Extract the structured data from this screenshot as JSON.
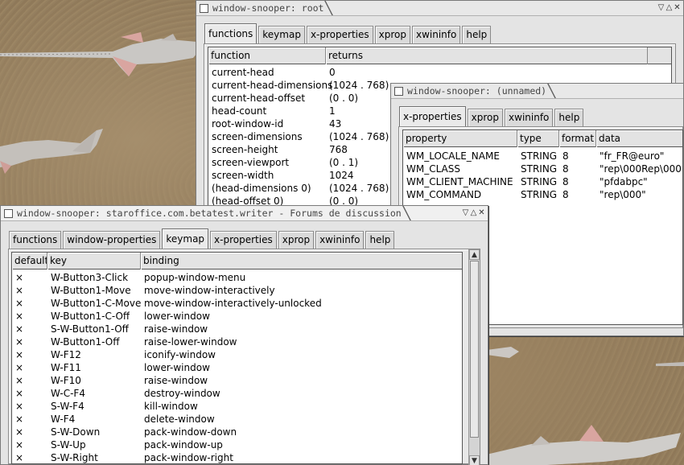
{
  "root_window": {
    "title": "window-snooper: root",
    "tabs": [
      "functions",
      "keymap",
      "x-properties",
      "xprop",
      "xwininfo",
      "help"
    ],
    "selected_tab": 0,
    "columns": [
      "function",
      "returns"
    ],
    "rows": [
      [
        "current-head",
        "0"
      ],
      [
        "current-head-dimensions",
        "(1024 . 768)"
      ],
      [
        "current-head-offset",
        "(0 . 0)"
      ],
      [
        "head-count",
        "1"
      ],
      [
        "root-window-id",
        "43"
      ],
      [
        "screen-dimensions",
        "(1024 . 768)"
      ],
      [
        "screen-height",
        "768"
      ],
      [
        "screen-viewport",
        "(0 . 1)"
      ],
      [
        "screen-width",
        "1024"
      ],
      [
        "(head-dimensions 0)",
        "(1024 . 768)"
      ],
      [
        "(head-offset 0)",
        "(0 . 0)"
      ]
    ]
  },
  "unnamed_window": {
    "title": "window-snooper: (unnamed)",
    "tabs": [
      "x-properties",
      "xprop",
      "xwininfo",
      "help"
    ],
    "selected_tab": 0,
    "columns": [
      "property",
      "type",
      "format",
      "data"
    ],
    "rows": [
      [
        "WM_LOCALE_NAME",
        "STRING",
        "8",
        "\"fr_FR@euro\""
      ],
      [
        "WM_CLASS",
        "STRING",
        "8",
        "\"rep\\000Rep\\000\""
      ],
      [
        "WM_CLIENT_MACHINE",
        "STRING",
        "8",
        "\"pfdabpc\""
      ],
      [
        "WM_COMMAND",
        "STRING",
        "8",
        "\"rep\\000\""
      ]
    ]
  },
  "writer_window": {
    "title": "window-snooper: staroffice.com.betatest.writer - Forums de discussion",
    "tabs": [
      "functions",
      "window-properties",
      "keymap",
      "x-properties",
      "xprop",
      "xwininfo",
      "help"
    ],
    "selected_tab": 2,
    "columns": [
      "default",
      "key",
      "binding"
    ],
    "rows": [
      [
        "×",
        "W-Button3-Click",
        "popup-window-menu"
      ],
      [
        "×",
        "W-Button1-Move",
        "move-window-interactively"
      ],
      [
        "×",
        "W-Button1-C-Move",
        "move-window-interactively-unlocked"
      ],
      [
        "×",
        "W-Button1-C-Off",
        "lower-window"
      ],
      [
        "×",
        "S-W-Button1-Off",
        "raise-window"
      ],
      [
        "×",
        "W-Button1-Off",
        "raise-lower-window"
      ],
      [
        "×",
        "W-F12",
        "iconify-window"
      ],
      [
        "×",
        "W-F11",
        "lower-window"
      ],
      [
        "×",
        "W-F10",
        "raise-window"
      ],
      [
        "×",
        "W-C-F4",
        "destroy-window"
      ],
      [
        "×",
        "S-W-F4",
        "kill-window"
      ],
      [
        "×",
        "W-F4",
        "delete-window"
      ],
      [
        "×",
        "S-W-Down",
        "pack-window-down"
      ],
      [
        "×",
        "S-W-Up",
        "pack-window-up"
      ],
      [
        "×",
        "S-W-Right",
        "pack-window-right"
      ]
    ]
  },
  "titlebar_buttons": {
    "iconify": "▽",
    "maximize": "△",
    "close": "✕"
  },
  "icons": [
    "window-box-icon",
    "iconify-icon",
    "maximize-icon",
    "close-icon",
    "scroll-up-icon",
    "scroll-down-icon"
  ],
  "colors": {
    "window_bg": "#e4e4e4",
    "list_bg": "#ffffff",
    "desktop": "#8a7557"
  }
}
